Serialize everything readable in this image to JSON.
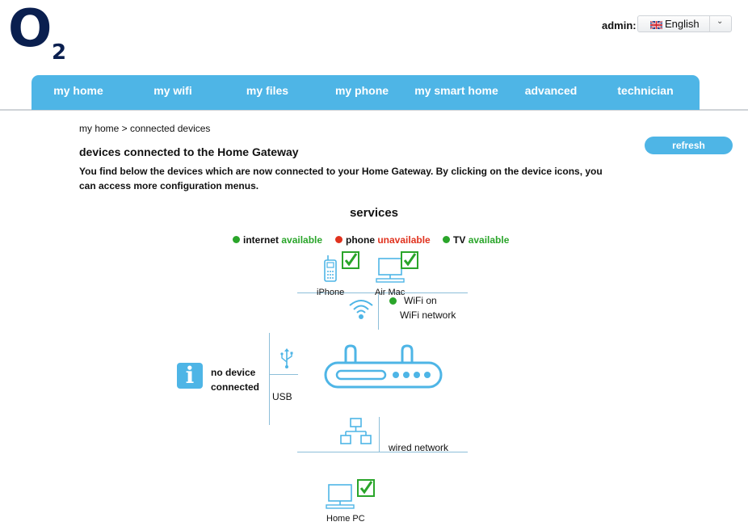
{
  "logo": {
    "letter": "O",
    "subscript": "2"
  },
  "header": {
    "admin_label": "admin:",
    "language": {
      "selected": "English",
      "flag_icon": "uk-flag-icon",
      "arrow_icon": "chevron-down-icon"
    }
  },
  "nav": {
    "items": [
      {
        "label": "my home"
      },
      {
        "label": "my wifi"
      },
      {
        "label": "my files"
      },
      {
        "label": "my phone"
      },
      {
        "label": "my smart home"
      },
      {
        "label": "advanced"
      },
      {
        "label": "technician"
      }
    ]
  },
  "breadcrumb": "my home > connected devices",
  "page_title": "devices connected to the Home Gateway",
  "refresh_label": "refresh",
  "description": "You find below the devices which are now connected to your Home Gateway. By clicking on the device icons, you can access more configuration menus.",
  "services": {
    "title": "services",
    "items": [
      {
        "name": "internet",
        "status": "available",
        "status_color": "#2aa52a",
        "dot_color": "#2aa52a"
      },
      {
        "name": "phone",
        "status": "unavailable",
        "status_color": "#e0321e",
        "dot_color": "#e0321e"
      },
      {
        "name": "TV",
        "status": "available",
        "status_color": "#2aa52a",
        "dot_color": "#2aa52a"
      }
    ]
  },
  "wifi": {
    "devices": [
      {
        "label": "iPhone",
        "icon": "phone-icon",
        "connected": true
      },
      {
        "label": "Air Mac",
        "icon": "computer-icon",
        "connected": true
      }
    ],
    "status": "WiFi on",
    "status_color": "#2aa52a",
    "network_label": "WiFi network"
  },
  "usb": {
    "label": "USB",
    "empty_text_line1": "no device",
    "empty_text_line2": "connected"
  },
  "wired": {
    "network_label": "wired network",
    "devices": [
      {
        "label": "Home PC",
        "icon": "computer-icon",
        "connected": true
      }
    ]
  },
  "colors": {
    "accent": "#4eb5e6",
    "logo": "#0a1f4f",
    "diagram_line": "#8dbfd9",
    "check": "#2aa52a"
  }
}
